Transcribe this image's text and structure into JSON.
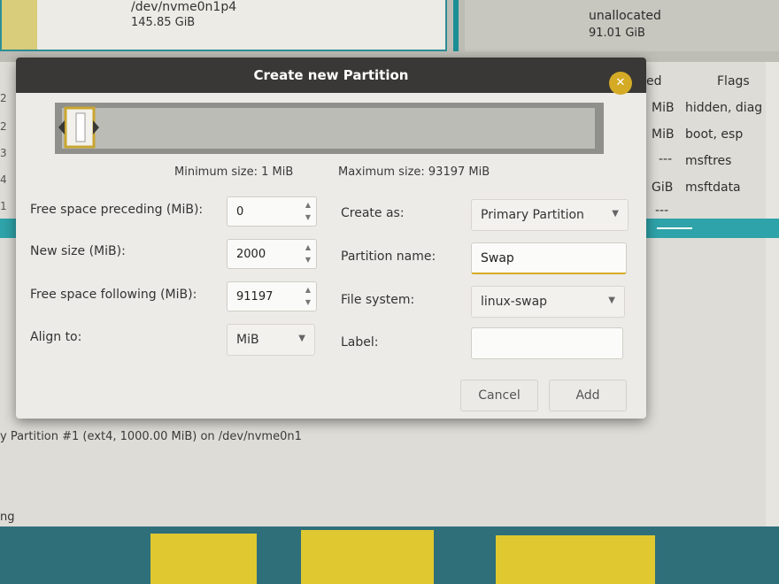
{
  "background": {
    "partition": {
      "name": "/dev/nvme0n1p4",
      "size": "145.85 GiB"
    },
    "unallocated": {
      "name": "unallocated",
      "size": "91.01 GiB"
    },
    "left_numbers": [
      "2",
      "3",
      "4",
      "1"
    ],
    "table": {
      "col_partial": "ed",
      "col_flags": "Flags",
      "rows": [
        {
          "size": "MiB",
          "flags": "hidden, diag"
        },
        {
          "size": "MiB",
          "flags": "boot, esp"
        },
        {
          "size": "---",
          "flags": "msftres"
        },
        {
          "size": "GiB",
          "flags": "msftdata"
        },
        {
          "size": "---",
          "flags": ""
        }
      ]
    },
    "status_line": "y Partition #1 (ext4, 1000.00 MiB) on /dev/nvme0n1",
    "status_bar": "ng",
    "colors": {
      "teal": "#2ea3a9",
      "accent": "#d5ab26"
    }
  },
  "dialog": {
    "title": "Create new Partition",
    "close_icon": "close-icon",
    "min_size": "Minimum size: 1 MiB",
    "max_size": "Maximum size: 93197 MiB",
    "fields": {
      "free_preceding": {
        "label": "Free space preceding (MiB):",
        "value": "0"
      },
      "new_size": {
        "label": "New size (MiB):",
        "value": "2000"
      },
      "free_following": {
        "label": "Free space following (MiB):",
        "value": "91197"
      },
      "align_to": {
        "label": "Align to:",
        "value": "MiB"
      },
      "create_as": {
        "label": "Create as:",
        "value": "Primary Partition"
      },
      "partition_name": {
        "label": "Partition name:",
        "value": "Swap"
      },
      "file_system": {
        "label": "File system:",
        "value": "linux-swap"
      },
      "label": {
        "label": "Label:",
        "value": ""
      }
    },
    "buttons": {
      "cancel": "Cancel",
      "add": "Add"
    }
  }
}
